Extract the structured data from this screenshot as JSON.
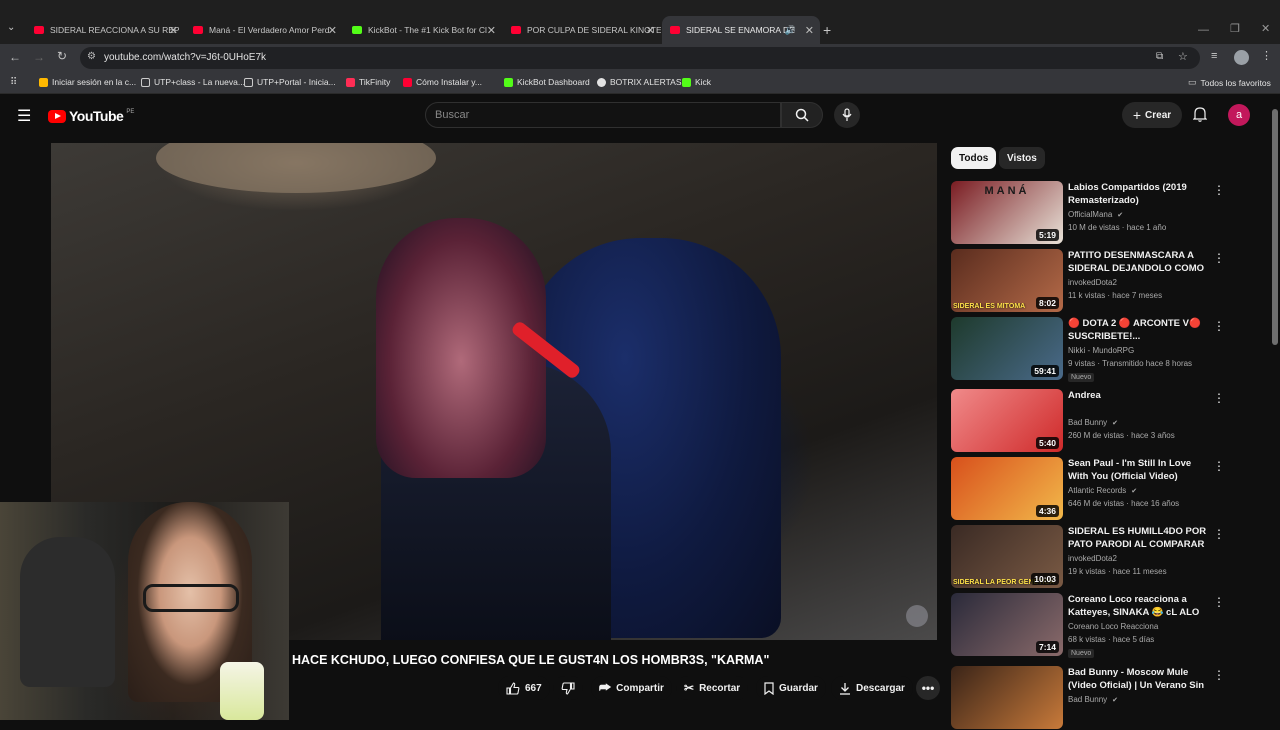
{
  "browser": {
    "tabs": [
      {
        "label": "SIDERAL REACCIONA A SU REP",
        "color": "#ff0033"
      },
      {
        "label": "Maná - El Verdadero Amor Perd",
        "color": "#ff0033"
      },
      {
        "label": "KickBot - The #1 Kick Bot for Cl",
        "color": "#53fc18"
      },
      {
        "label": "POR CULPA DE SIDERAL KINGTE",
        "color": "#ff0033"
      },
      {
        "label": "SIDERAL SE ENAMORA DE",
        "color": "#ff0033"
      }
    ],
    "url": "youtube.com/watch?v=J6t-0UHoE7k",
    "bookmarks": [
      {
        "label": "Iniciar sesión en la c...",
        "color": "#ffb900"
      },
      {
        "label": "UTP+class - La nueva...",
        "color": "#e3e3e3"
      },
      {
        "label": "UTP+Portal - Inicia...",
        "color": "#e3e3e3"
      },
      {
        "label": "TikFinity",
        "color": "#ff2d55"
      },
      {
        "label": "Cómo Instalar y...",
        "color": "#ff0033"
      },
      {
        "label": "KickBot Dashboard",
        "color": "#53fc18"
      },
      {
        "label": "BOTRIX ALERTAS",
        "color": "#e3e3e3"
      },
      {
        "label": "Kick",
        "color": "#53fc18"
      }
    ],
    "all_bookmarks": "Todos los favoritos"
  },
  "header": {
    "logo_text": "YouTube",
    "country_code": "PE",
    "search_placeholder": "Buscar",
    "create_label": "Crear",
    "avatar_letter": "a"
  },
  "video": {
    "title": "HACE KCHUDO, LUEGO CONFIESA QUE LE GUST4N LOS HOMBR3S, \"KARMA\"",
    "like_count": "667",
    "actions": {
      "share": "Compartir",
      "clip": "Recortar",
      "save": "Guardar",
      "download": "Descargar"
    }
  },
  "chips": [
    "Todos",
    "Vistos"
  ],
  "recommendations": [
    {
      "title": "Labios Compartidos (2019 Remasterizado)",
      "channel": "OfficialMana",
      "verified": true,
      "meta": "10 M de vistas · hace 1 año",
      "duration": "5:19",
      "badge": "",
      "thumb_colors": [
        "#7a1c22",
        "#e8e2d8"
      ],
      "thumb_caption": "MANÁ"
    },
    {
      "title": "PATITO DESENMASCARA A SIDERAL DEJANDOLO COMO ...",
      "channel": "invokedDota2",
      "verified": false,
      "meta": "11 k vistas · hace 7 meses",
      "duration": "8:02",
      "badge": "",
      "thumb_colors": [
        "#5a2c1e",
        "#b46a48"
      ],
      "thumb_caption": "SIDERAL ES MITÓMA"
    },
    {
      "title": "🔴 DOTA 2 🔴 ARCONTE V🔴 SUSCRIBETE!...",
      "channel": "Nikki - MundoRPG",
      "verified": false,
      "meta": "9 vistas · Transmitido hace 8 horas",
      "duration": "59:41",
      "badge": "Nuevo",
      "thumb_colors": [
        "#1e3a2c",
        "#4a6a8a"
      ],
      "thumb_caption": ""
    },
    {
      "title": "Andrea",
      "channel": "Bad Bunny",
      "verified": true,
      "meta": "260 M de vistas · hace 3 años",
      "duration": "5:40",
      "badge": "",
      "thumb_colors": [
        "#f08a8a",
        "#cf2a2a"
      ],
      "thumb_caption": ""
    },
    {
      "title": "Sean Paul - I'm Still In Love With You (Official Video)",
      "channel": "Atlantic Records",
      "verified": true,
      "meta": "646 M de vistas · hace 16 años",
      "duration": "4:36",
      "badge": "",
      "thumb_colors": [
        "#d8501c",
        "#f2b84a"
      ],
      "thumb_caption": ""
    },
    {
      "title": "SIDERAL ES HUMILL4DO POR PATO PARODI AL COMPARAR ...",
      "channel": "invokedDota2",
      "verified": false,
      "meta": "19 k vistas · hace 11 meses",
      "duration": "10:03",
      "badge": "",
      "thumb_colors": [
        "#3a2a24",
        "#7a5a44"
      ],
      "thumb_caption": "SIDERAL LA PEOR GENETICA"
    },
    {
      "title": "Coreano Loco reacciona a Katteyes, SINAKA 😂 cL ALO",
      "channel": "Coreano Loco Reacciona",
      "verified": false,
      "meta": "68 k vistas · hace 5 días",
      "duration": "7:14",
      "badge": "Nuevo",
      "thumb_colors": [
        "#2a2a3a",
        "#8a6a6a"
      ],
      "thumb_caption": ""
    },
    {
      "title": "Bad Bunny - Moscow Mule (Video Oficial) | Un Verano Sin ...",
      "channel": "Bad Bunny",
      "verified": true,
      "meta": "",
      "duration": "",
      "badge": "",
      "thumb_colors": [
        "#3a2418",
        "#c87a3a"
      ],
      "thumb_caption": ""
    }
  ],
  "colors": {
    "accent": "#ff0000",
    "background": "#0f0f0f",
    "avatar": "#c2185b"
  }
}
